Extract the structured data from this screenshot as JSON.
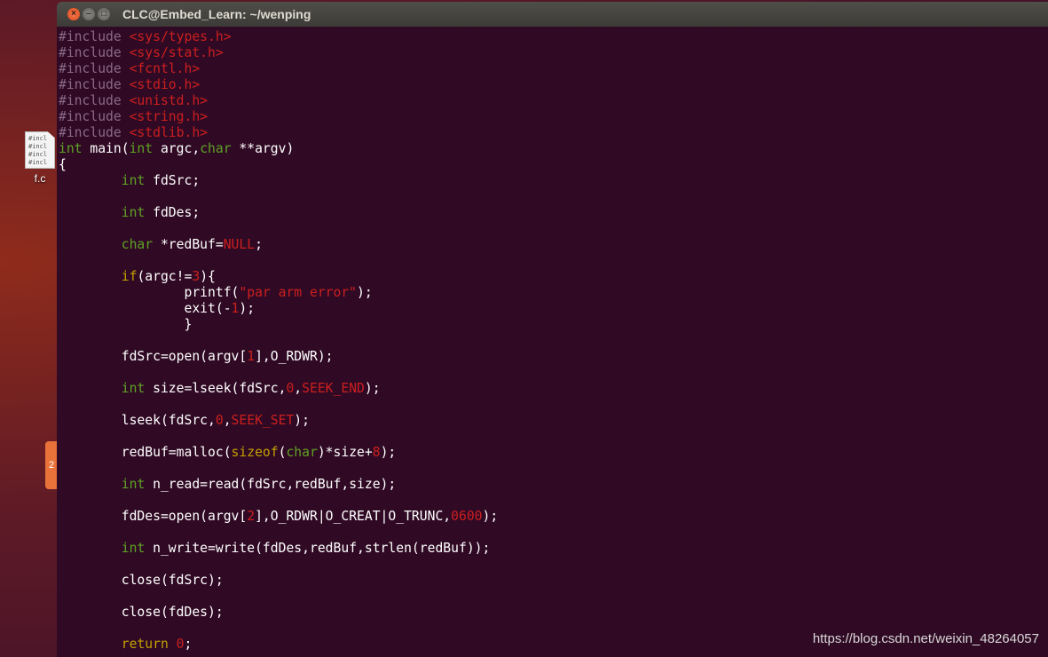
{
  "window": {
    "title": "CLC@Embed_Learn: ~/wenping"
  },
  "desktop": {
    "file_icon": {
      "label": "f.c",
      "preview": [
        "#incl",
        "#incl",
        "#incl",
        "#incl"
      ]
    },
    "launcher_badge": "2"
  },
  "watermark": "https://blog.csdn.net/weixin_48264057",
  "code_lines": [
    [
      {
        "t": "#include ",
        "c": "pre"
      },
      {
        "t": "<sys/types.h>",
        "c": "hdr"
      }
    ],
    [
      {
        "t": "#include ",
        "c": "pre"
      },
      {
        "t": "<sys/stat.h>",
        "c": "hdr"
      }
    ],
    [
      {
        "t": "#include ",
        "c": "pre"
      },
      {
        "t": "<fcntl.h>",
        "c": "hdr"
      }
    ],
    [
      {
        "t": "#include ",
        "c": "pre"
      },
      {
        "t": "<stdio.h>",
        "c": "hdr"
      }
    ],
    [
      {
        "t": "#include ",
        "c": "pre"
      },
      {
        "t": "<unistd.h>",
        "c": "hdr"
      }
    ],
    [
      {
        "t": "#include ",
        "c": "pre"
      },
      {
        "t": "<string.h>",
        "c": "hdr"
      }
    ],
    [
      {
        "t": "#include ",
        "c": "pre"
      },
      {
        "t": "<stdlib.h>",
        "c": "hdr"
      }
    ],
    [
      {
        "t": "int",
        "c": "type"
      },
      {
        "t": " main(",
        "c": "txt"
      },
      {
        "t": "int",
        "c": "type"
      },
      {
        "t": " argc,",
        "c": "txt"
      },
      {
        "t": "char",
        "c": "type"
      },
      {
        "t": " **argv)",
        "c": "txt"
      }
    ],
    [
      {
        "t": "{",
        "c": "txt"
      }
    ],
    [
      {
        "t": "        ",
        "c": "txt"
      },
      {
        "t": "int",
        "c": "type"
      },
      {
        "t": " fdSrc;",
        "c": "txt"
      }
    ],
    [],
    [
      {
        "t": "        ",
        "c": "txt"
      },
      {
        "t": "int",
        "c": "type"
      },
      {
        "t": " fdDes;",
        "c": "txt"
      }
    ],
    [],
    [
      {
        "t": "        ",
        "c": "txt"
      },
      {
        "t": "char",
        "c": "type"
      },
      {
        "t": " *redBuf=",
        "c": "txt"
      },
      {
        "t": "NULL",
        "c": "const"
      },
      {
        "t": ";",
        "c": "txt"
      }
    ],
    [],
    [
      {
        "t": "        ",
        "c": "txt"
      },
      {
        "t": "if",
        "c": "kw"
      },
      {
        "t": "(argc!=",
        "c": "txt"
      },
      {
        "t": "3",
        "c": "num"
      },
      {
        "t": "){",
        "c": "txt"
      }
    ],
    [
      {
        "t": "                printf(",
        "c": "txt"
      },
      {
        "t": "\"par arm error\"",
        "c": "str"
      },
      {
        "t": ");",
        "c": "txt"
      }
    ],
    [
      {
        "t": "                exit(-",
        "c": "txt"
      },
      {
        "t": "1",
        "c": "num"
      },
      {
        "t": ");",
        "c": "txt"
      }
    ],
    [
      {
        "t": "                }",
        "c": "txt"
      }
    ],
    [],
    [
      {
        "t": "        fdSrc=open(argv[",
        "c": "txt"
      },
      {
        "t": "1",
        "c": "num"
      },
      {
        "t": "],O_RDWR);",
        "c": "txt"
      }
    ],
    [],
    [
      {
        "t": "        ",
        "c": "txt"
      },
      {
        "t": "int",
        "c": "type"
      },
      {
        "t": " size=lseek(fdSrc,",
        "c": "txt"
      },
      {
        "t": "0",
        "c": "num"
      },
      {
        "t": ",",
        "c": "txt"
      },
      {
        "t": "SEEK_END",
        "c": "const"
      },
      {
        "t": ");",
        "c": "txt"
      }
    ],
    [],
    [
      {
        "t": "        lseek(fdSrc,",
        "c": "txt"
      },
      {
        "t": "0",
        "c": "num"
      },
      {
        "t": ",",
        "c": "txt"
      },
      {
        "t": "SEEK_SET",
        "c": "const"
      },
      {
        "t": ");",
        "c": "txt"
      }
    ],
    [],
    [
      {
        "t": "        redBuf=malloc(",
        "c": "txt"
      },
      {
        "t": "sizeof",
        "c": "kw"
      },
      {
        "t": "(",
        "c": "txt"
      },
      {
        "t": "char",
        "c": "type"
      },
      {
        "t": ")*size+",
        "c": "txt"
      },
      {
        "t": "8",
        "c": "num"
      },
      {
        "t": ");",
        "c": "txt"
      }
    ],
    [],
    [
      {
        "t": "        ",
        "c": "txt"
      },
      {
        "t": "int",
        "c": "type"
      },
      {
        "t": " n_read=read(fdSrc,redBuf,size);",
        "c": "txt"
      }
    ],
    [],
    [
      {
        "t": "        fdDes=open(argv[",
        "c": "txt"
      },
      {
        "t": "2",
        "c": "num"
      },
      {
        "t": "],O_RDWR|O_CREAT|O_TRUNC,",
        "c": "txt"
      },
      {
        "t": "0600",
        "c": "num"
      },
      {
        "t": ");",
        "c": "txt"
      }
    ],
    [],
    [
      {
        "t": "        ",
        "c": "txt"
      },
      {
        "t": "int",
        "c": "type"
      },
      {
        "t": " n_write=write(fdDes,redBuf,strlen(redBuf));",
        "c": "txt"
      }
    ],
    [],
    [
      {
        "t": "        close(fdSrc);",
        "c": "txt"
      }
    ],
    [],
    [
      {
        "t": "        close(fdDes);",
        "c": "txt"
      }
    ],
    [],
    [
      {
        "t": "        ",
        "c": "txt"
      },
      {
        "t": "return",
        "c": "kw"
      },
      {
        "t": " ",
        "c": "txt"
      },
      {
        "t": "0",
        "c": "num"
      },
      {
        "t": ";",
        "c": "txt"
      }
    ]
  ]
}
